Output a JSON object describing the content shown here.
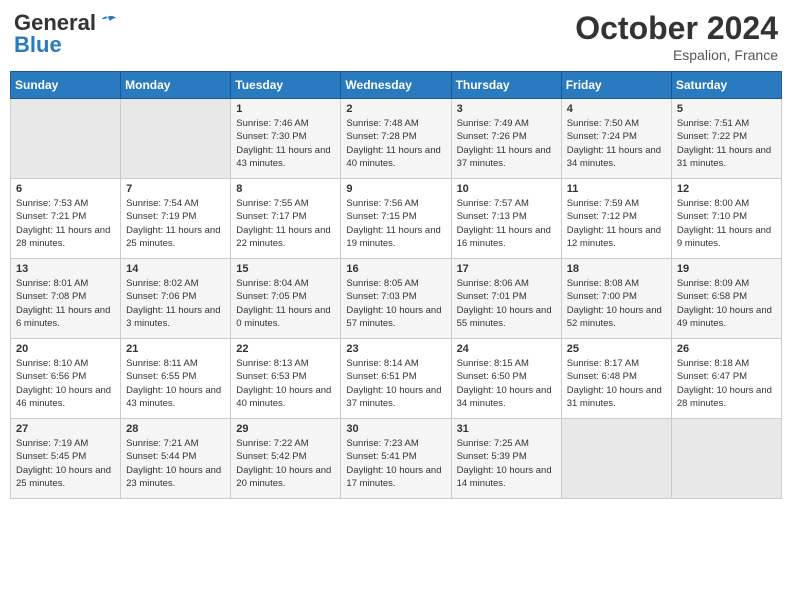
{
  "header": {
    "logo_general": "General",
    "logo_blue": "Blue",
    "month": "October 2024",
    "location": "Espalion, France"
  },
  "days_of_week": [
    "Sunday",
    "Monday",
    "Tuesday",
    "Wednesday",
    "Thursday",
    "Friday",
    "Saturday"
  ],
  "weeks": [
    [
      {
        "day": "",
        "empty": true
      },
      {
        "day": "",
        "empty": true
      },
      {
        "day": "1",
        "sunrise": "Sunrise: 7:46 AM",
        "sunset": "Sunset: 7:30 PM",
        "daylight": "Daylight: 11 hours and 43 minutes."
      },
      {
        "day": "2",
        "sunrise": "Sunrise: 7:48 AM",
        "sunset": "Sunset: 7:28 PM",
        "daylight": "Daylight: 11 hours and 40 minutes."
      },
      {
        "day": "3",
        "sunrise": "Sunrise: 7:49 AM",
        "sunset": "Sunset: 7:26 PM",
        "daylight": "Daylight: 11 hours and 37 minutes."
      },
      {
        "day": "4",
        "sunrise": "Sunrise: 7:50 AM",
        "sunset": "Sunset: 7:24 PM",
        "daylight": "Daylight: 11 hours and 34 minutes."
      },
      {
        "day": "5",
        "sunrise": "Sunrise: 7:51 AM",
        "sunset": "Sunset: 7:22 PM",
        "daylight": "Daylight: 11 hours and 31 minutes."
      }
    ],
    [
      {
        "day": "6",
        "sunrise": "Sunrise: 7:53 AM",
        "sunset": "Sunset: 7:21 PM",
        "daylight": "Daylight: 11 hours and 28 minutes."
      },
      {
        "day": "7",
        "sunrise": "Sunrise: 7:54 AM",
        "sunset": "Sunset: 7:19 PM",
        "daylight": "Daylight: 11 hours and 25 minutes."
      },
      {
        "day": "8",
        "sunrise": "Sunrise: 7:55 AM",
        "sunset": "Sunset: 7:17 PM",
        "daylight": "Daylight: 11 hours and 22 minutes."
      },
      {
        "day": "9",
        "sunrise": "Sunrise: 7:56 AM",
        "sunset": "Sunset: 7:15 PM",
        "daylight": "Daylight: 11 hours and 19 minutes."
      },
      {
        "day": "10",
        "sunrise": "Sunrise: 7:57 AM",
        "sunset": "Sunset: 7:13 PM",
        "daylight": "Daylight: 11 hours and 16 minutes."
      },
      {
        "day": "11",
        "sunrise": "Sunrise: 7:59 AM",
        "sunset": "Sunset: 7:12 PM",
        "daylight": "Daylight: 11 hours and 12 minutes."
      },
      {
        "day": "12",
        "sunrise": "Sunrise: 8:00 AM",
        "sunset": "Sunset: 7:10 PM",
        "daylight": "Daylight: 11 hours and 9 minutes."
      }
    ],
    [
      {
        "day": "13",
        "sunrise": "Sunrise: 8:01 AM",
        "sunset": "Sunset: 7:08 PM",
        "daylight": "Daylight: 11 hours and 6 minutes."
      },
      {
        "day": "14",
        "sunrise": "Sunrise: 8:02 AM",
        "sunset": "Sunset: 7:06 PM",
        "daylight": "Daylight: 11 hours and 3 minutes."
      },
      {
        "day": "15",
        "sunrise": "Sunrise: 8:04 AM",
        "sunset": "Sunset: 7:05 PM",
        "daylight": "Daylight: 11 hours and 0 minutes."
      },
      {
        "day": "16",
        "sunrise": "Sunrise: 8:05 AM",
        "sunset": "Sunset: 7:03 PM",
        "daylight": "Daylight: 10 hours and 57 minutes."
      },
      {
        "day": "17",
        "sunrise": "Sunrise: 8:06 AM",
        "sunset": "Sunset: 7:01 PM",
        "daylight": "Daylight: 10 hours and 55 minutes."
      },
      {
        "day": "18",
        "sunrise": "Sunrise: 8:08 AM",
        "sunset": "Sunset: 7:00 PM",
        "daylight": "Daylight: 10 hours and 52 minutes."
      },
      {
        "day": "19",
        "sunrise": "Sunrise: 8:09 AM",
        "sunset": "Sunset: 6:58 PM",
        "daylight": "Daylight: 10 hours and 49 minutes."
      }
    ],
    [
      {
        "day": "20",
        "sunrise": "Sunrise: 8:10 AM",
        "sunset": "Sunset: 6:56 PM",
        "daylight": "Daylight: 10 hours and 46 minutes."
      },
      {
        "day": "21",
        "sunrise": "Sunrise: 8:11 AM",
        "sunset": "Sunset: 6:55 PM",
        "daylight": "Daylight: 10 hours and 43 minutes."
      },
      {
        "day": "22",
        "sunrise": "Sunrise: 8:13 AM",
        "sunset": "Sunset: 6:53 PM",
        "daylight": "Daylight: 10 hours and 40 minutes."
      },
      {
        "day": "23",
        "sunrise": "Sunrise: 8:14 AM",
        "sunset": "Sunset: 6:51 PM",
        "daylight": "Daylight: 10 hours and 37 minutes."
      },
      {
        "day": "24",
        "sunrise": "Sunrise: 8:15 AM",
        "sunset": "Sunset: 6:50 PM",
        "daylight": "Daylight: 10 hours and 34 minutes."
      },
      {
        "day": "25",
        "sunrise": "Sunrise: 8:17 AM",
        "sunset": "Sunset: 6:48 PM",
        "daylight": "Daylight: 10 hours and 31 minutes."
      },
      {
        "day": "26",
        "sunrise": "Sunrise: 8:18 AM",
        "sunset": "Sunset: 6:47 PM",
        "daylight": "Daylight: 10 hours and 28 minutes."
      }
    ],
    [
      {
        "day": "27",
        "sunrise": "Sunrise: 7:19 AM",
        "sunset": "Sunset: 5:45 PM",
        "daylight": "Daylight: 10 hours and 25 minutes."
      },
      {
        "day": "28",
        "sunrise": "Sunrise: 7:21 AM",
        "sunset": "Sunset: 5:44 PM",
        "daylight": "Daylight: 10 hours and 23 minutes."
      },
      {
        "day": "29",
        "sunrise": "Sunrise: 7:22 AM",
        "sunset": "Sunset: 5:42 PM",
        "daylight": "Daylight: 10 hours and 20 minutes."
      },
      {
        "day": "30",
        "sunrise": "Sunrise: 7:23 AM",
        "sunset": "Sunset: 5:41 PM",
        "daylight": "Daylight: 10 hours and 17 minutes."
      },
      {
        "day": "31",
        "sunrise": "Sunrise: 7:25 AM",
        "sunset": "Sunset: 5:39 PM",
        "daylight": "Daylight: 10 hours and 14 minutes."
      },
      {
        "day": "",
        "empty": true
      },
      {
        "day": "",
        "empty": true
      }
    ]
  ]
}
